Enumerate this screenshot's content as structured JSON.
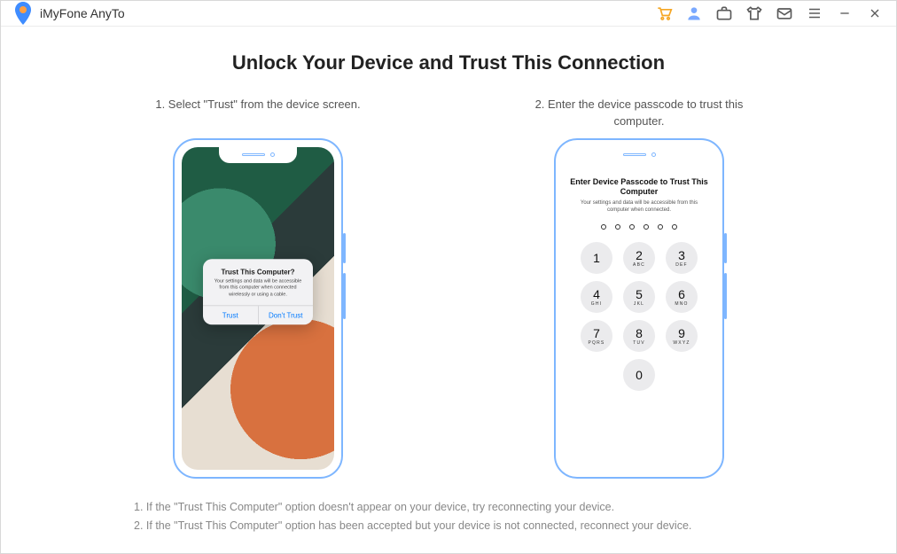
{
  "app": {
    "title": "iMyFone AnyTo"
  },
  "main": {
    "title": "Unlock Your Device and Trust This Connection",
    "step1": "1. Select \"Trust\" from the device screen.",
    "step2": "2. Enter the device passcode to trust this computer."
  },
  "trust_dialog": {
    "title": "Trust This Computer?",
    "message": "Your settings and data will be accessible from this computer when connected wirelessly or using a cable.",
    "trust": "Trust",
    "dont_trust": "Don't Trust"
  },
  "passcode": {
    "title": "Enter Device Passcode to Trust This Computer",
    "message": "Your settings and data will be accessible from this computer when connected.",
    "keys": [
      {
        "n": "1",
        "l": ""
      },
      {
        "n": "2",
        "l": "ABC"
      },
      {
        "n": "3",
        "l": "DEF"
      },
      {
        "n": "4",
        "l": "GHI"
      },
      {
        "n": "5",
        "l": "JKL"
      },
      {
        "n": "6",
        "l": "MNO"
      },
      {
        "n": "7",
        "l": "PQRS"
      },
      {
        "n": "8",
        "l": "TUV"
      },
      {
        "n": "9",
        "l": "WXYZ"
      }
    ],
    "zero": {
      "n": "0",
      "l": ""
    }
  },
  "tips": {
    "line1": "1. If the \"Trust This Computer\" option doesn't appear on your device, try reconnecting your device.",
    "line2": "2. If the \"Trust This Computer\" option has been accepted but your device is not connected, reconnect your device."
  }
}
